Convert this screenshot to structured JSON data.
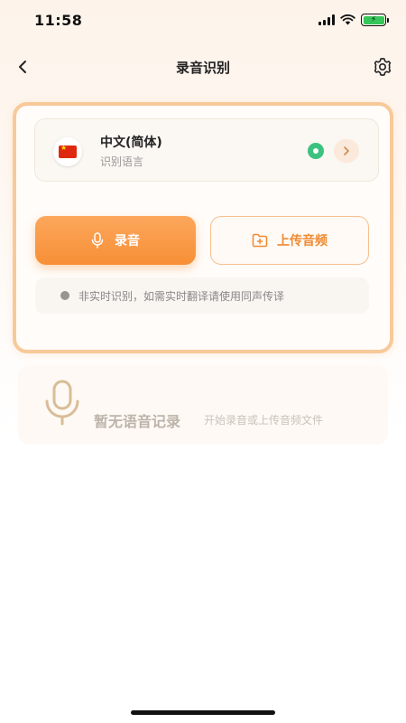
{
  "status": {
    "time": "11:58"
  },
  "nav": {
    "title": "录音识别"
  },
  "language": {
    "name": "中文(简体)",
    "subtitle": "识别语言"
  },
  "actions": {
    "record_label": "录音",
    "upload_label": "上传音频"
  },
  "notice": {
    "text": "非实时识别，如需实时翻译请使用同声传译"
  },
  "empty": {
    "title": "暂无语音记录",
    "subtitle": "开始录音或上传音频文件"
  },
  "colors": {
    "accent": "#f78f36",
    "accent_border": "#f8c999",
    "status_green": "#3cc27f"
  },
  "icons": [
    "chevron-left-icon",
    "gear-icon",
    "china-flag-icon",
    "chevron-right-icon",
    "mic-icon",
    "folder-plus-icon",
    "info-icon"
  ]
}
